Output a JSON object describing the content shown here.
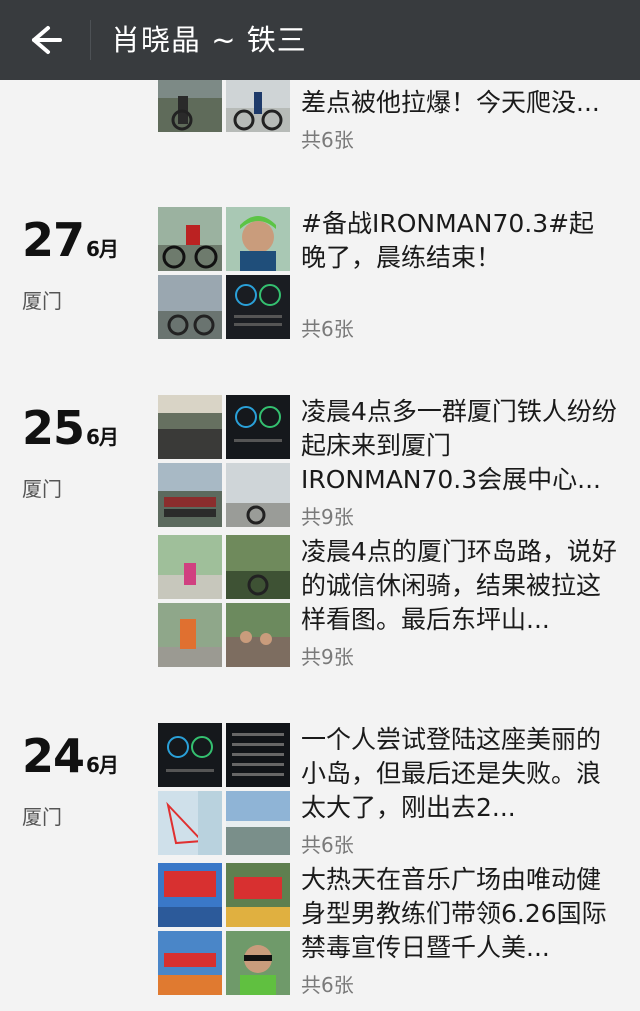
{
  "header": {
    "title": "肖晓晶 ~ 铁三"
  },
  "posts": [
    {
      "text": "差点被他拉爆！今天爬没...",
      "count": "共6张"
    },
    {
      "day": "27",
      "month": "6月",
      "location": "厦门",
      "text": "#备战IRONMAN70.3#起晚了，晨练结束！",
      "count": "共6张"
    },
    {
      "day": "25",
      "month": "6月",
      "location": "厦门",
      "text": "凌晨4点多一群厦门铁人纷纷起床来到厦门IRONMAN70.3会展中心...",
      "count": "共9张"
    },
    {
      "text": "凌晨4点的厦门环岛路，说好的诚信休闲骑，结果被拉这样看图。最后东坪山...",
      "count": "共9张"
    },
    {
      "day": "24",
      "month": "6月",
      "location": "厦门",
      "text": "一个人尝试登陆这座美丽的小岛，但最后还是失败。浪太大了，刚出去2...",
      "count": "共6张"
    },
    {
      "text": "大热天在音乐广场由唯动健身型男教练们带领6.26国际禁毒宣传日暨千人美...",
      "count": "共6张"
    }
  ],
  "icons": {
    "back": "arrow-left-icon"
  },
  "colors": {
    "header_bg": "#383b3e",
    "page_bg": "#f3f3f3",
    "muted_text": "#7a7a7a"
  }
}
